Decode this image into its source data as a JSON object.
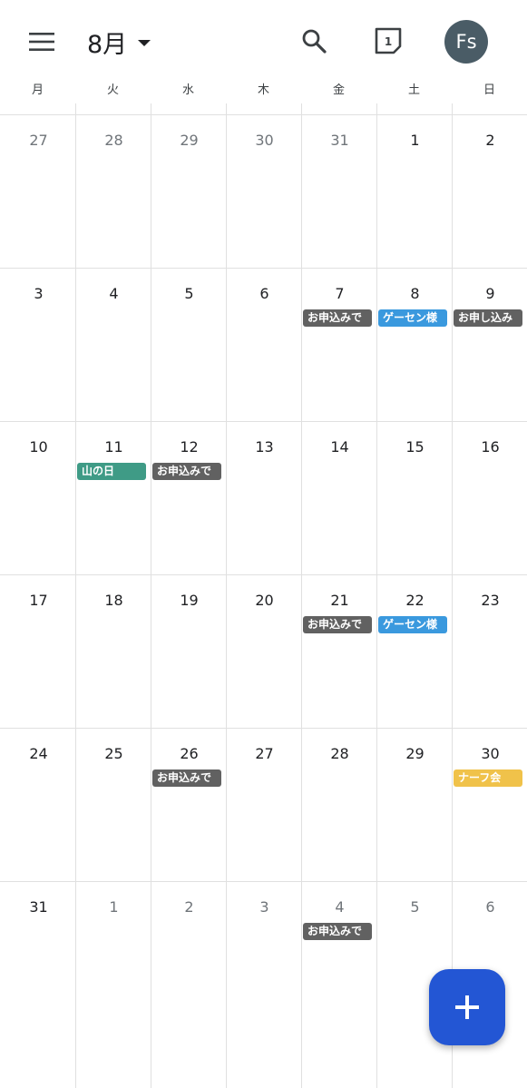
{
  "header": {
    "month_label": "8月",
    "today_label": "1",
    "avatar_initials": "Fs"
  },
  "weekdays": [
    "月",
    "火",
    "水",
    "木",
    "金",
    "土",
    "日"
  ],
  "colors": {
    "gray_event": "#616161",
    "blue_event": "#3a99de",
    "green_event": "#3f9b86",
    "yellow_event": "#f0c24a",
    "fab": "#2356d4",
    "avatar": "#4a5c66"
  },
  "weeks": [
    [
      {
        "day": "27",
        "in_month": false,
        "event": null
      },
      {
        "day": "28",
        "in_month": false,
        "event": null
      },
      {
        "day": "29",
        "in_month": false,
        "event": null
      },
      {
        "day": "30",
        "in_month": false,
        "event": null
      },
      {
        "day": "31",
        "in_month": false,
        "event": null
      },
      {
        "day": "1",
        "in_month": true,
        "event": null
      },
      {
        "day": "2",
        "in_month": true,
        "event": null
      }
    ],
    [
      {
        "day": "3",
        "in_month": true,
        "event": null
      },
      {
        "day": "4",
        "in_month": true,
        "event": null
      },
      {
        "day": "5",
        "in_month": true,
        "event": null
      },
      {
        "day": "6",
        "in_month": true,
        "event": null
      },
      {
        "day": "7",
        "in_month": true,
        "event": {
          "title": "お申込みで",
          "color": "#616161"
        }
      },
      {
        "day": "8",
        "in_month": true,
        "event": {
          "title": "ゲーセン様",
          "color": "#3a99de"
        }
      },
      {
        "day": "9",
        "in_month": true,
        "event": {
          "title": "お申し込み",
          "color": "#616161"
        }
      }
    ],
    [
      {
        "day": "10",
        "in_month": true,
        "event": null
      },
      {
        "day": "11",
        "in_month": true,
        "event": {
          "title": "山の日",
          "color": "#3f9b86"
        }
      },
      {
        "day": "12",
        "in_month": true,
        "event": {
          "title": "お申込みで",
          "color": "#616161"
        }
      },
      {
        "day": "13",
        "in_month": true,
        "event": null
      },
      {
        "day": "14",
        "in_month": true,
        "event": null
      },
      {
        "day": "15",
        "in_month": true,
        "event": null
      },
      {
        "day": "16",
        "in_month": true,
        "event": null
      }
    ],
    [
      {
        "day": "17",
        "in_month": true,
        "event": null
      },
      {
        "day": "18",
        "in_month": true,
        "event": null
      },
      {
        "day": "19",
        "in_month": true,
        "event": null
      },
      {
        "day": "20",
        "in_month": true,
        "event": null
      },
      {
        "day": "21",
        "in_month": true,
        "event": {
          "title": "お申込みで",
          "color": "#616161"
        }
      },
      {
        "day": "22",
        "in_month": true,
        "event": {
          "title": "ゲーセン様",
          "color": "#3a99de"
        }
      },
      {
        "day": "23",
        "in_month": true,
        "event": null
      }
    ],
    [
      {
        "day": "24",
        "in_month": true,
        "event": null
      },
      {
        "day": "25",
        "in_month": true,
        "event": null
      },
      {
        "day": "26",
        "in_month": true,
        "event": {
          "title": "お申込みで",
          "color": "#616161"
        }
      },
      {
        "day": "27",
        "in_month": true,
        "event": null
      },
      {
        "day": "28",
        "in_month": true,
        "event": null
      },
      {
        "day": "29",
        "in_month": true,
        "event": null
      },
      {
        "day": "30",
        "in_month": true,
        "event": {
          "title": "ナーフ会",
          "color": "#f0c24a"
        }
      }
    ],
    [
      {
        "day": "31",
        "in_month": true,
        "event": null
      },
      {
        "day": "1",
        "in_month": false,
        "event": null
      },
      {
        "day": "2",
        "in_month": false,
        "event": null
      },
      {
        "day": "3",
        "in_month": false,
        "event": null
      },
      {
        "day": "4",
        "in_month": false,
        "event": {
          "title": "お申込みで",
          "color": "#616161"
        }
      },
      {
        "day": "5",
        "in_month": false,
        "event": null
      },
      {
        "day": "6",
        "in_month": false,
        "event": null
      }
    ]
  ]
}
